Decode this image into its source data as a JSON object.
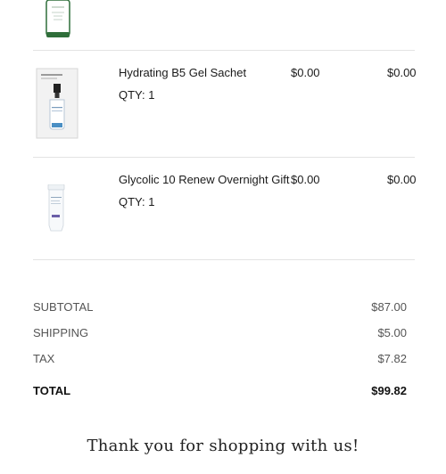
{
  "items": [
    {
      "name": "",
      "qty": "",
      "price": "",
      "total": "",
      "image_icon": "green-serum-bottle-icon"
    },
    {
      "name": "Hydrating B5 Gel Sachet",
      "qty": "QTY: 1",
      "price": "$0.00",
      "total": "$0.00",
      "image_icon": "serum-sachet-icon"
    },
    {
      "name": "Glycolic 10 Renew Overnight Gift",
      "qty": "QTY: 1",
      "price": "$0.00",
      "total": "$0.00",
      "image_icon": "cream-tube-icon"
    }
  ],
  "summary": {
    "subtotal_label": "SUBTOTAL",
    "subtotal_value": "$87.00",
    "shipping_label": "SHIPPING",
    "shipping_value": "$5.00",
    "tax_label": "TAX",
    "tax_value": "$7.82",
    "total_label": "TOTAL",
    "total_value": "$99.82"
  },
  "footer": {
    "thank_you": "Thank you for shopping with us!"
  },
  "colors": {
    "divider": "#e3e3e3",
    "text": "#1a1a1a",
    "muted": "#555555",
    "bottle_green": "#2f6e3a",
    "dropper_blue": "#4a8fc4"
  }
}
